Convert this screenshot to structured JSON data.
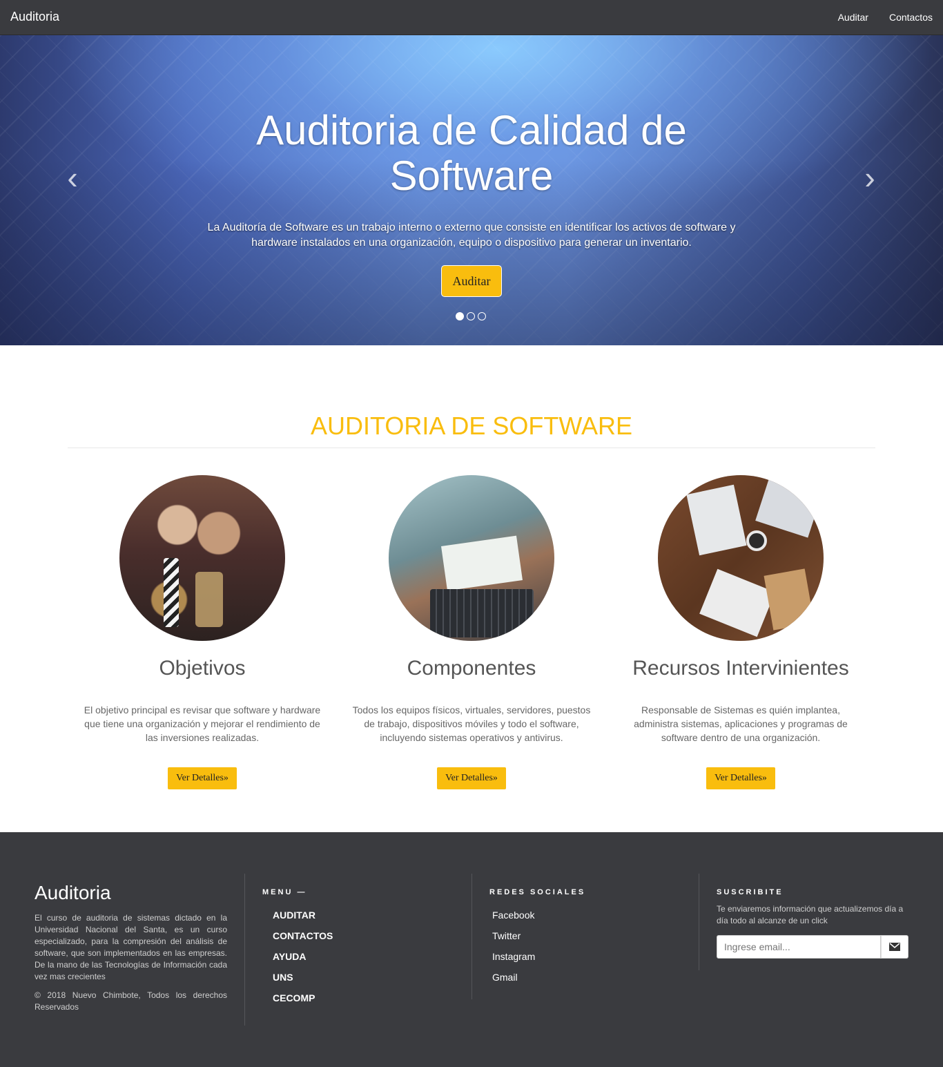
{
  "navbar": {
    "brand": "Auditoria",
    "links": [
      "Auditar",
      "Contactos"
    ]
  },
  "hero": {
    "title": "Auditoria de Calidad de Software",
    "description": "La Auditoría de Software es un trabajo interno o externo que consiste en identificar los activos de software y hardware instalados en una organización, equipo o dispositivo para generar un inventario.",
    "button_label": "Auditar",
    "prev_icon": "chevron-left-icon",
    "next_icon": "chevron-right-icon",
    "slide_count": 3,
    "active_slide": 1
  },
  "section": {
    "title": "AUDITORIA DE SOFTWARE",
    "features": [
      {
        "image": "team-fist-bump-photo",
        "title": "Objetivos",
        "text": "El objetivo principal es revisar que software y hardware que tiene una organización y mejorar el rendimiento de las inversiones realizadas.",
        "button_label": "Ver Detalles»"
      },
      {
        "image": "laptop-notes-photo",
        "title": "Componentes",
        "text": "Todos los equipos físicos, virtuales, servidores, puestos de trabajo, dispositivos móviles y todo el software, incluyendo sistemas operativos y antivirus.",
        "button_label": "Ver Detalles»"
      },
      {
        "image": "desk-papers-photo",
        "title": "Recursos Intervinientes",
        "text": "Responsable de Sistemas es quién implantea, administra sistemas, aplicaciones y programas de software dentro de una organización.",
        "button_label": "Ver Detalles»"
      }
    ]
  },
  "footer": {
    "brand": "Auditoria",
    "about": "El curso de auditoria de sistemas dictado en la Universidad Nacional del Santa, es un curso especializado, para la compresión del análisis de software, que son implementados en las empresas. De la mano de las Tecnologías de Información cada vez mas crecientes",
    "copyright": "© 2018 Nuevo Chimbote, Todos los derechos Reservados",
    "menu_heading": "MENU —",
    "menu_items": [
      "AUDITAR",
      "CONTACTOS",
      "AYUDA",
      "UNS",
      "CECOMP"
    ],
    "social_heading": "REDES SOCIALES",
    "social_items": [
      "Facebook",
      "Twitter",
      "Instagram",
      "Gmail"
    ],
    "subscribe_heading": "SUSCRIBITE",
    "subscribe_text": "Te enviaremos información que actualizemos día a día todo al alcanze de un click",
    "email_placeholder": "Ingrese email...",
    "send_icon": "envelope-icon"
  },
  "colors": {
    "accent": "#f9bd0e",
    "navbar_bg": "#3a3b3f",
    "footer_bg": "#3a3b3f"
  }
}
